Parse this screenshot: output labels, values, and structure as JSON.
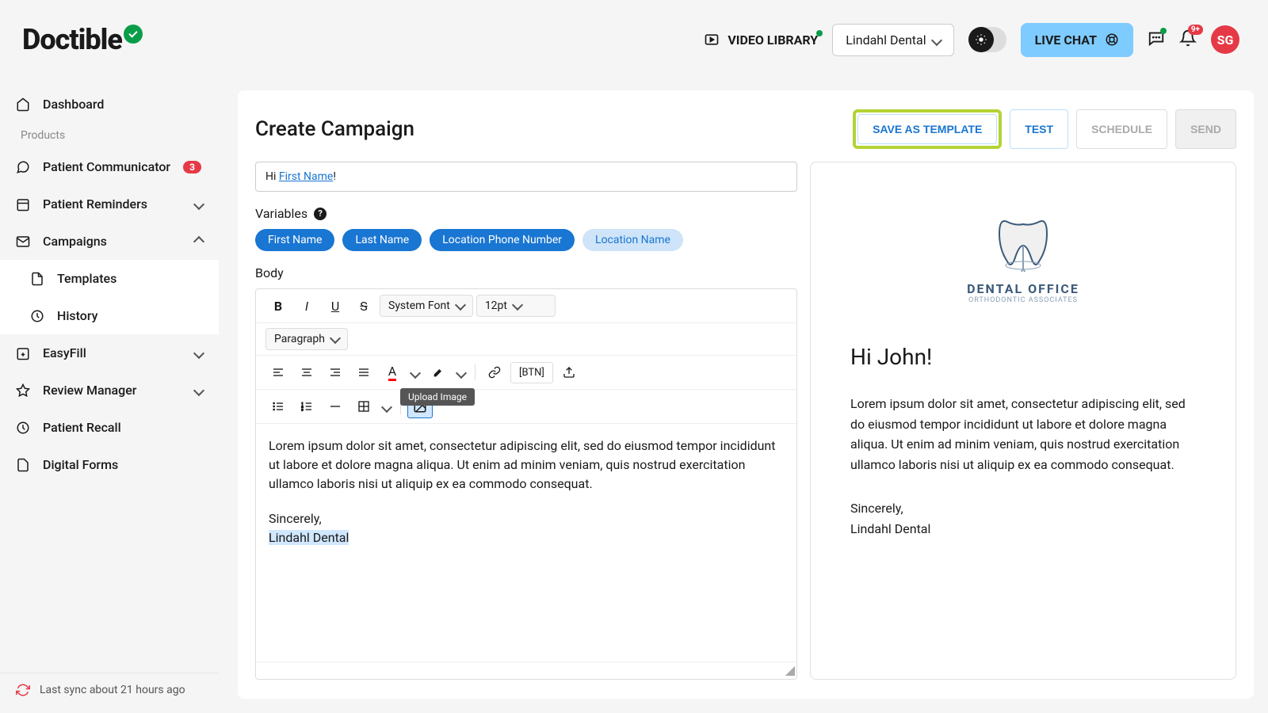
{
  "brand": "Doctible",
  "header": {
    "video_library": "VIDEO LIBRARY",
    "practice": "Lindahl Dental",
    "live_chat": "LIVE CHAT",
    "notif_count": "9+",
    "avatar_initials": "SG"
  },
  "sidebar": {
    "dashboard": "Dashboard",
    "products_label": "Products",
    "patient_communicator": "Patient Communicator",
    "patient_communicator_badge": "3",
    "patient_reminders": "Patient Reminders",
    "campaigns": "Campaigns",
    "templates": "Templates",
    "history": "History",
    "easyfill": "EasyFill",
    "review_manager": "Review Manager",
    "patient_recall": "Patient Recall",
    "digital_forms": "Digital Forms",
    "sync_status": "Last sync about 21 hours ago"
  },
  "page": {
    "title": "Create Campaign",
    "buttons": {
      "save_template": "SAVE AS TEMPLATE",
      "test": "TEST",
      "schedule": "SCHEDULE",
      "send": "SEND"
    }
  },
  "editor": {
    "greeting_prefix": "Hi ",
    "greeting_var": "First Name",
    "greeting_suffix": "!",
    "variables_label": "Variables",
    "chips": {
      "first_name": "First Name",
      "last_name": "Last Name",
      "location_phone": "Location Phone Number",
      "location_name": "Location Name"
    },
    "body_label": "Body",
    "toolbar": {
      "font": "System Font",
      "size": "12pt",
      "block": "Paragraph",
      "image_tooltip": "Upload Image",
      "btn_label": "[BTN]"
    },
    "body_text": "Lorem ipsum dolor sit amet, consectetur adipiscing elit, sed do eiusmod tempor incididunt ut labore et dolore magna aliqua. Ut enim ad minim veniam, quis nostrud exercitation ullamco laboris nisi ut aliquip ex ea commodo consequat.",
    "signoff": "Sincerely,",
    "company": "Lindahl Dental"
  },
  "preview": {
    "brand": "DENTAL OFFICE",
    "sub": "ORTHODONTIC ASSOCIATES",
    "greeting": "Hi John!",
    "body": "Lorem ipsum dolor sit amet, consectetur adipiscing elit, sed do eiusmod tempor incididunt ut labore et dolore magna aliqua. Ut enim ad minim veniam, quis nostrud exercitation ullamco laboris nisi ut aliquip ex ea commodo consequat.",
    "signoff": "Sincerely,",
    "company": "Lindahl Dental"
  }
}
